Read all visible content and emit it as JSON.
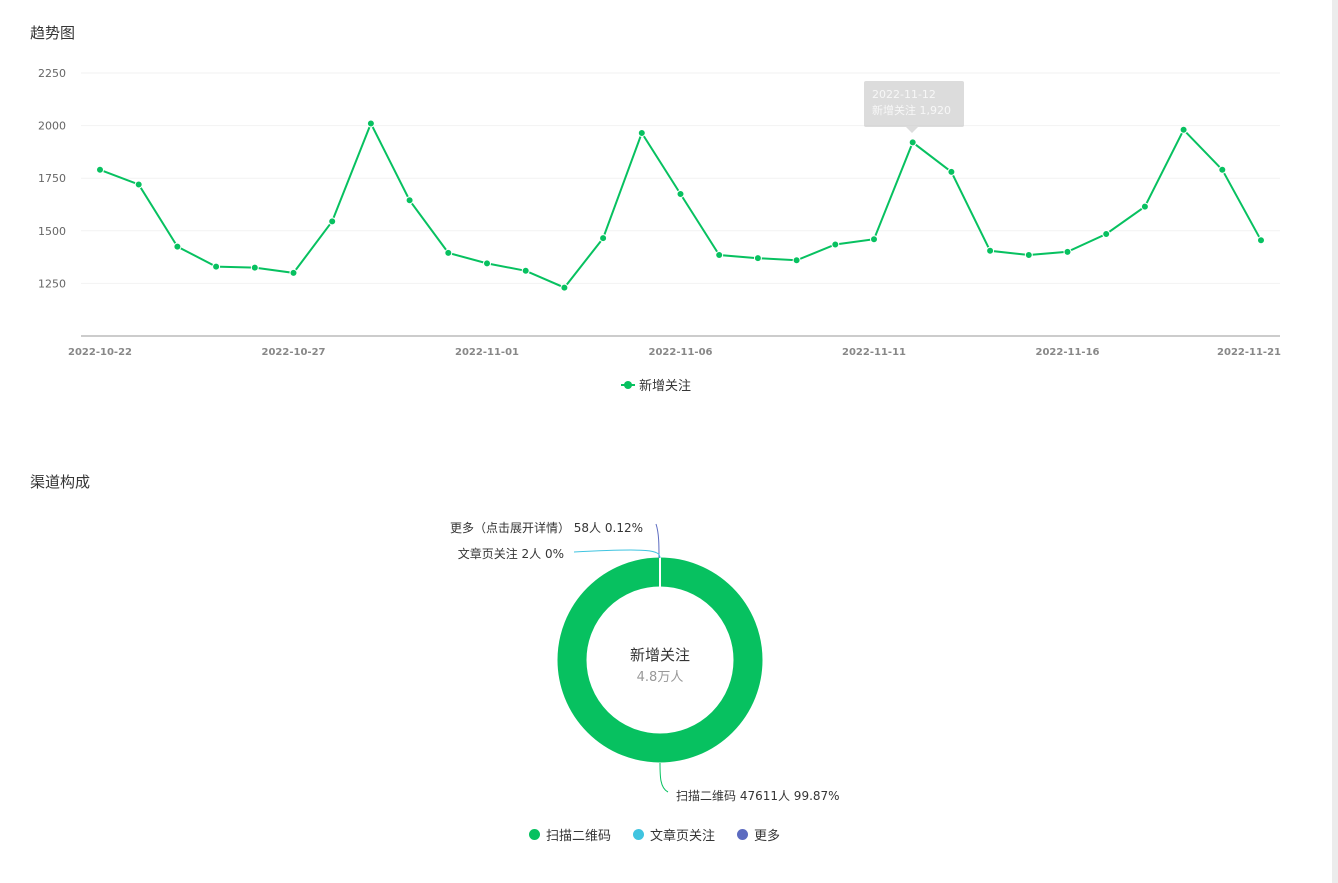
{
  "sections": {
    "trend_title": "趋势图",
    "channel_title": "渠道构成"
  },
  "tooltip": {
    "date": "2022-11-12",
    "value_text": "新增关注 1,920"
  },
  "colors": {
    "line": "#07c160",
    "scan": "#07c160",
    "article": "#40c4e0",
    "more": "#5c6bc0"
  },
  "chart_data": [
    {
      "type": "line",
      "title": "",
      "xlabel": "",
      "ylabel": "",
      "ylim": [
        1000,
        2250
      ],
      "yticks": [
        1250,
        1500,
        1750,
        2000,
        2250
      ],
      "xtick_labels": [
        "2022-10-22",
        "2022-10-27",
        "2022-11-01",
        "2022-11-06",
        "2022-11-11",
        "2022-11-16",
        "2022-11-21"
      ],
      "x": [
        "2022-10-22",
        "2022-10-23",
        "2022-10-24",
        "2022-10-25",
        "2022-10-26",
        "2022-10-27",
        "2022-10-28",
        "2022-10-29",
        "2022-10-30",
        "2022-10-31",
        "2022-11-01",
        "2022-11-02",
        "2022-11-03",
        "2022-11-04",
        "2022-11-05",
        "2022-11-06",
        "2022-11-07",
        "2022-11-08",
        "2022-11-09",
        "2022-11-10",
        "2022-11-11",
        "2022-11-12",
        "2022-11-13",
        "2022-11-14",
        "2022-11-15",
        "2022-11-16",
        "2022-11-17",
        "2022-11-18",
        "2022-11-19",
        "2022-11-20",
        "2022-11-21"
      ],
      "series": [
        {
          "name": "新增关注",
          "values": [
            1790,
            1720,
            1425,
            1330,
            1325,
            1300,
            1545,
            2010,
            1645,
            1395,
            1345,
            1310,
            1230,
            1465,
            1965,
            1675,
            1385,
            1370,
            1360,
            1435,
            1460,
            1920,
            1780,
            1405,
            1385,
            1400,
            1485,
            1615,
            1980,
            1790,
            1455
          ]
        }
      ],
      "legend": "bottom-center",
      "grid": true
    },
    {
      "type": "pie",
      "title": "",
      "center_label": "新增关注",
      "center_value": "4.8万人",
      "slices": [
        {
          "name": "扫描二维码",
          "label": "扫描二维码 47611人 99.87%",
          "value": 47611,
          "percent": 99.87
        },
        {
          "name": "文章页关注",
          "label": "文章页关注 2人 0%",
          "value": 2,
          "percent": 0
        },
        {
          "name": "更多",
          "label": "更多（点击展开详情） 58人 0.12%",
          "value": 58,
          "percent": 0.12
        }
      ],
      "legend": "bottom-center"
    }
  ]
}
